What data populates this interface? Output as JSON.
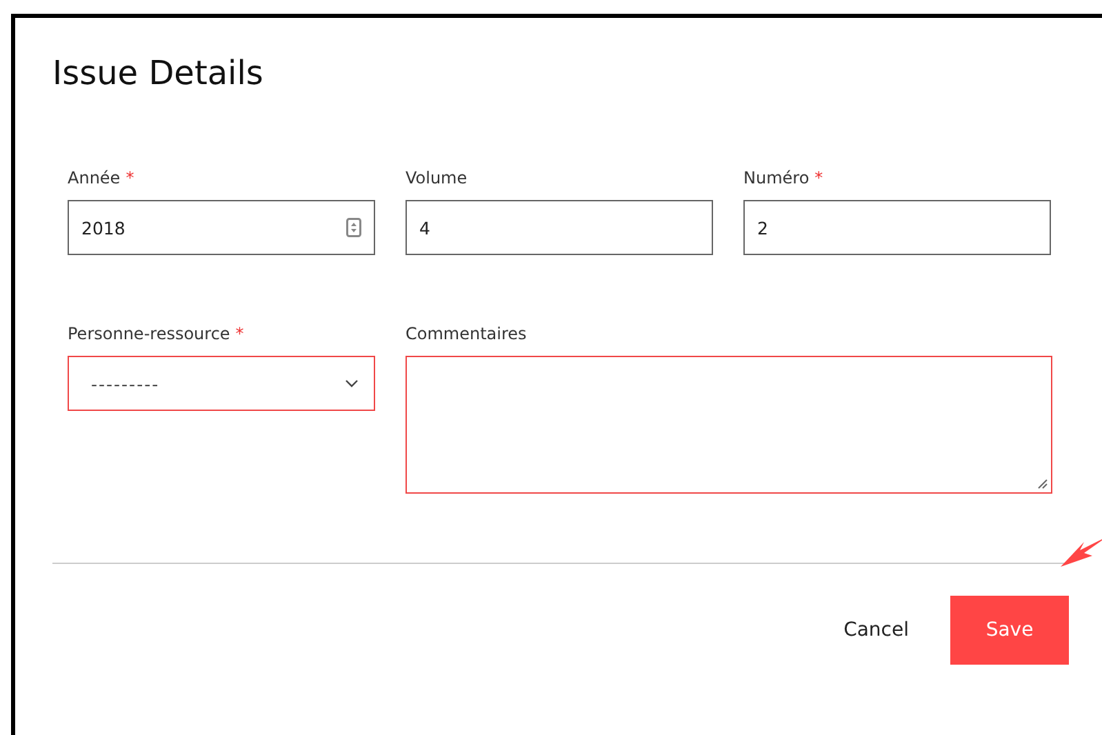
{
  "dialog": {
    "title": "Issue Details"
  },
  "field_rows": [
    [
      {
        "label": "Année",
        "required": true,
        "kind": "number",
        "value": "2018",
        "invalid": false
      },
      {
        "label": "Volume",
        "required": false,
        "kind": "text",
        "value": "4",
        "invalid": false
      },
      {
        "label": "Numéro",
        "required": true,
        "kind": "text",
        "value": "2",
        "invalid": false
      }
    ],
    [
      {
        "label": "Personne-ressource",
        "required": true,
        "kind": "select",
        "value": "---------",
        "invalid": true
      },
      {
        "label": "Commentaires",
        "required": false,
        "kind": "textarea",
        "invalid": true
      }
    ]
  ],
  "required_mark": "*",
  "buttons": [
    {
      "label": "Cancel",
      "kind": "secondary"
    },
    {
      "label": "Save",
      "kind": "primary"
    }
  ]
}
